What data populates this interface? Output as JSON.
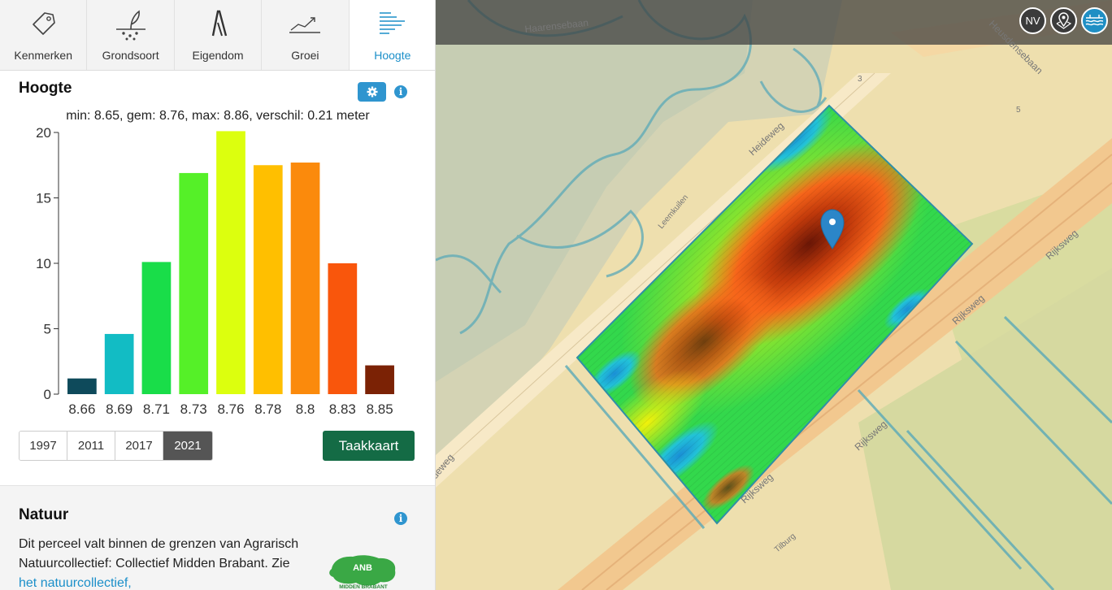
{
  "tabs": [
    {
      "label": "Kenmerken",
      "icon": "tag-icon"
    },
    {
      "label": "Grondsoort",
      "icon": "sprout-icon"
    },
    {
      "label": "Eigendom",
      "icon": "ownership-icon"
    },
    {
      "label": "Groei",
      "icon": "growth-chart-icon"
    },
    {
      "label": "Hoogte",
      "icon": "elevation-icon"
    }
  ],
  "active_tab": "Hoogte",
  "hoogte": {
    "title": "Hoogte",
    "stats": "min: 8.65, gem: 8.76, max: 8.86, verschil: 0.21 meter",
    "years": [
      "1997",
      "2011",
      "2017",
      "2021"
    ],
    "selected_year": "2021",
    "taakkaart_label": "Taakkaart"
  },
  "chart_data": {
    "type": "bar",
    "categories": [
      "8.66",
      "8.69",
      "8.71",
      "8.73",
      "8.76",
      "8.78",
      "8.8",
      "8.83",
      "8.85"
    ],
    "values": [
      1.2,
      4.6,
      10.1,
      16.9,
      20.1,
      17.5,
      17.7,
      10.0,
      2.2
    ],
    "colors": [
      "#0e4a5b",
      "#12bcc4",
      "#19dd49",
      "#55f028",
      "#dcff0e",
      "#ffbf00",
      "#fb8a0c",
      "#f9560c",
      "#7b2205"
    ],
    "ylim": [
      0,
      20
    ],
    "yticks": [
      0,
      5,
      10,
      15,
      20
    ],
    "grid": false
  },
  "natuur": {
    "title": "Natuur",
    "text": "Dit perceel valt binnen de grenzen van Agrarisch Natuurcollectief: Collectief Midden Brabant. Zie ",
    "link": "het natuurcollectief,",
    "logo_text": "ANB",
    "logo_subtext": "MIDDEN BRABANT"
  },
  "map": {
    "buttons": [
      {
        "label": "NV"
      },
      {
        "icon": "map-pin-icon"
      },
      {
        "icon": "water-layer-icon"
      }
    ],
    "street_labels": [
      "Haarensebaan",
      "Heusdensebaan",
      "Heideweg",
      "Leemkuilen",
      "Rijksweg",
      "Rijksweg",
      "Rijksweg",
      "Rijksweg",
      "Tilburg",
      "deweg"
    ],
    "house_numbers": [
      "3",
      "5"
    ]
  },
  "colors": {
    "accent": "#1b8fc9",
    "button_green": "#146b45",
    "info_blue": "#2f95cf"
  }
}
